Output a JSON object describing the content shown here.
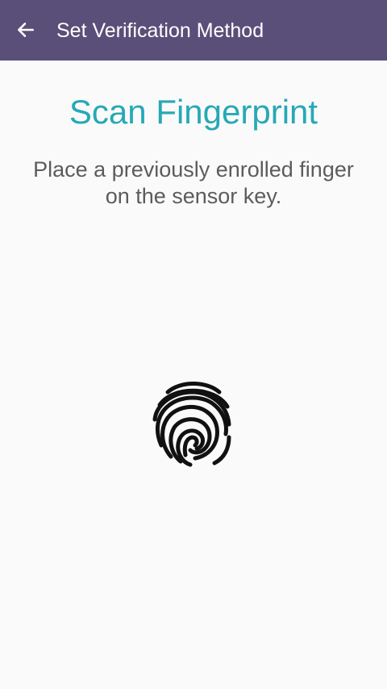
{
  "app_bar": {
    "title": "Set Verification Method",
    "back_icon": "arrow-left-icon",
    "background_color": "#5a4f78"
  },
  "content": {
    "heading": "Scan Fingerprint",
    "heading_color": "#26a9b5",
    "instruction": "Place a previously enrolled finger on the sensor key.",
    "fingerprint_icon": "fingerprint-icon"
  }
}
